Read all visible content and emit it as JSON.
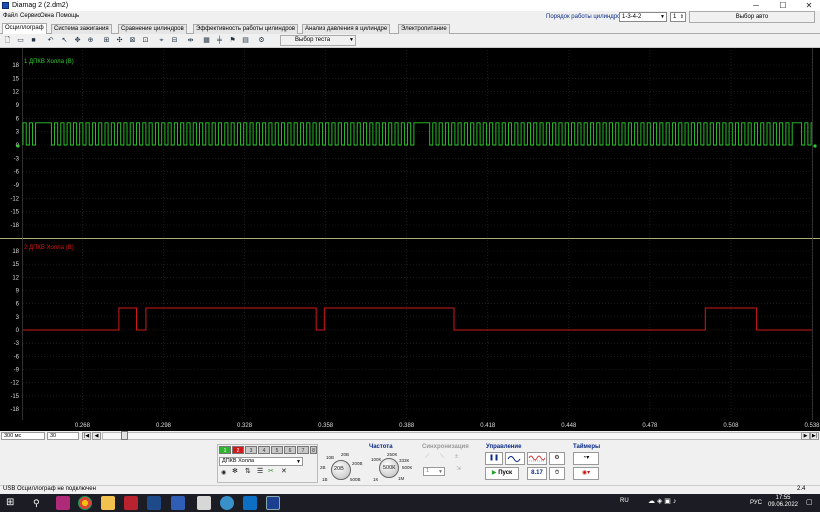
{
  "window": {
    "title": "Diamag 2 (2.dm2)",
    "minimize": "─",
    "maximize": "☐",
    "close": "✕"
  },
  "menu": {
    "items": [
      "Файл",
      "Сервис",
      "Окна",
      "Помощь"
    ]
  },
  "cylinder_order": {
    "label": "Порядок работы цилиндров",
    "value": "1-3-4-2",
    "spin_value": "1",
    "auto_select": "Выбор авто"
  },
  "tabs": [
    "Осциллограф",
    "Система зажигания",
    "Сравнение цилиндров",
    "Эффективность работы цилиндров",
    "Анализ давления в цилиндре",
    "Электропитание"
  ],
  "toolbar": {
    "test_select": "Выбор теста",
    "icons": [
      "new-file-icon",
      "open-folder-icon",
      "save-icon",
      "undo-icon",
      "cursor-icon",
      "measure-icon",
      "zoom-icon",
      "separator-icon",
      "time-marker-icon",
      "freq-icon",
      "amplitude-icon",
      "pulse-icon",
      "filter-icon",
      "grid-icon",
      "spread-icon",
      "marker-icon",
      "print-icon",
      "settings-icon"
    ]
  },
  "scope": {
    "channel1": {
      "label": "1 ДПКВ Холла (В)",
      "color": "#2ecc2e"
    },
    "channel2": {
      "label": "2 ДПКВ Холла (В)",
      "color": "#d21818"
    },
    "y_ticks": [
      "18",
      "15",
      "12",
      "9",
      "6",
      "3",
      "0",
      "-3",
      "-6",
      "-9",
      "-12",
      "-15",
      "-18"
    ],
    "y_ticks_ch2": [
      "18",
      "15",
      "12",
      "9",
      "6",
      "3",
      "0",
      "-3",
      "-6",
      "-9",
      "-12",
      "-15",
      "-18"
    ],
    "x_ticks": [
      "0.268",
      "0.298",
      "0.328",
      "0.358",
      "0.388",
      "0.418",
      "0.448",
      "0.478",
      "0.508",
      "0.538"
    ]
  },
  "chart_data": {
    "type": "line",
    "x": [
      "0.268",
      "0.298",
      "0.328",
      "0.358",
      "0.388",
      "0.418",
      "0.448",
      "0.478",
      "0.508",
      "0.538"
    ],
    "xlim": [
      0.246,
      0.538
    ],
    "ylim": [
      -18,
      18
    ],
    "series": [
      {
        "name": "1 ДПКВ Холла (В)",
        "signal": "square wave 0 / 5 V, ~58 pulses per revolution",
        "low": 0,
        "high": 5,
        "gap_windows": [
          [
            0.2505,
            0.2545
          ],
          [
            0.3905,
            0.3945
          ],
          [
            0.53,
            0.534
          ]
        ]
      },
      {
        "name": "2 ДПКВ Холла (В)",
        "signal": "square wave 0 / 5 V",
        "low": 0,
        "high": 5,
        "high_intervals": [
          [
            0.2815,
            0.288
          ],
          [
            0.2915,
            0.3545
          ],
          [
            0.3575,
            0.4055
          ],
          [
            0.4985,
            0.5175
          ]
        ]
      }
    ]
  },
  "bottom_row": {
    "timebase": "300 мс",
    "samples": "30"
  },
  "channels": {
    "buttons": [
      "1",
      "2",
      "3",
      "4",
      "5",
      "6",
      "7",
      "8"
    ],
    "sensor": "ДПКВ Холла",
    "knob_value": "20В",
    "knob_labels": [
      "10В",
      "20В",
      "50В",
      "100В",
      "200В",
      "500В",
      "1В",
      "2В",
      "5В"
    ]
  },
  "frequency": {
    "label": "Частота",
    "value": "500К",
    "labels": [
      "100К",
      "250К",
      "333К",
      "500К",
      "1К",
      "1М"
    ]
  },
  "sync": {
    "label": "Синхронизация",
    "value": "1"
  },
  "control": {
    "label": "Управление",
    "pause": "❚❚",
    "start": "Пуск",
    "counter": "8.17"
  },
  "timers": {
    "label": "Таймеры"
  },
  "status": {
    "text": "USB Осциллограф не подключен",
    "right": "2.4"
  },
  "taskbar": {
    "lang": "RU",
    "lang_alt": "РУС",
    "time": "17:55",
    "date": "09.06.2022"
  }
}
